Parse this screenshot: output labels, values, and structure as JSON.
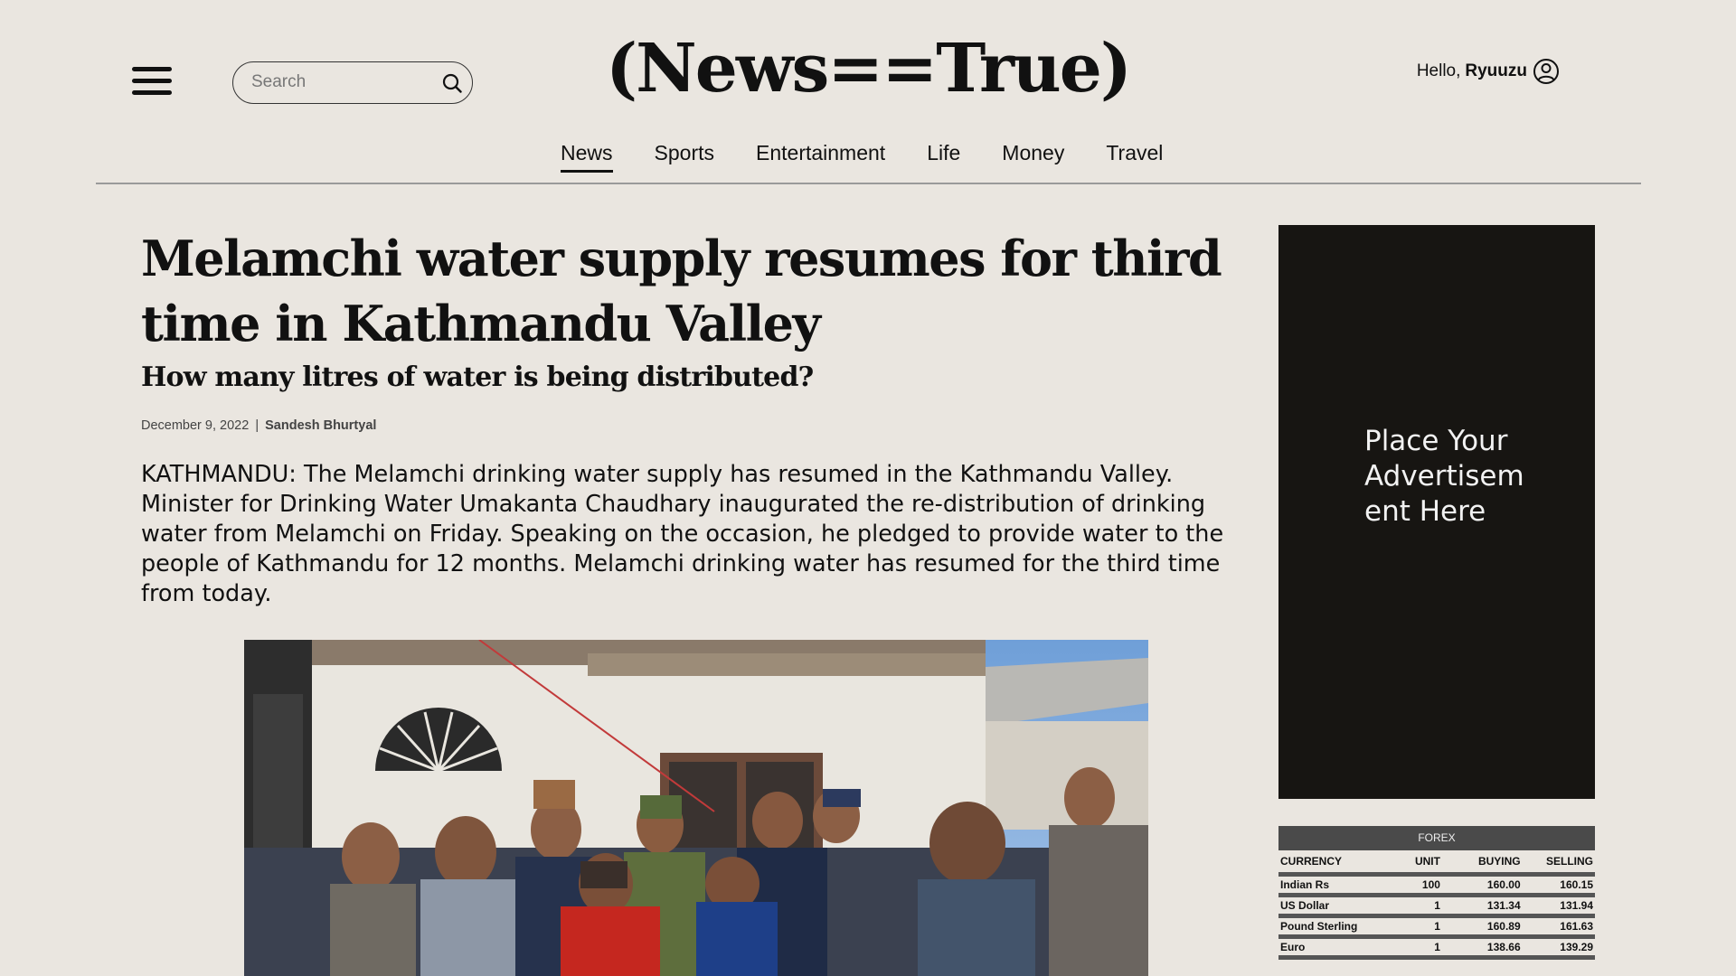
{
  "header": {
    "logo": "(News==True)",
    "search_placeholder": "Search",
    "greeting": "Hello,",
    "username": "Ryuuzu"
  },
  "nav": {
    "items": [
      {
        "label": "News",
        "active": true
      },
      {
        "label": "Sports",
        "active": false
      },
      {
        "label": "Entertainment",
        "active": false
      },
      {
        "label": "Life",
        "active": false
      },
      {
        "label": "Money",
        "active": false
      },
      {
        "label": "Travel",
        "active": false
      }
    ]
  },
  "article": {
    "headline": "Melamchi water supply resumes for third time in Kathmandu Valley",
    "subheadline": "How many litres of water is being distributed?",
    "date": "December 9, 2022",
    "separator": "|",
    "author": "Sandesh Bhurtyal",
    "body": "KATHMANDU: The Melamchi drinking water supply has resumed in the Kathmandu Valley. Minister for Drinking Water Umakanta Chaudhary inaugurated the re-distribution of drinking water from Melamchi on Friday. Speaking on the occasion, he pledged to provide water to the people of Kathmandu for 12 months. Melamchi drinking water has resumed for the third time from today."
  },
  "ad": {
    "text": "Place Your Advertisement Here"
  },
  "forex": {
    "title": "FOREX",
    "columns": [
      "CURRENCY",
      "UNIT",
      "BUYING",
      "SELLING"
    ],
    "rows": [
      [
        "Indian Rs",
        "100",
        "160.00",
        "160.15"
      ],
      [
        "US Dollar",
        "1",
        "131.34",
        "131.94"
      ],
      [
        "Pound Sterling",
        "1",
        "160.89",
        "161.63"
      ],
      [
        "Euro",
        "1",
        "138.66",
        "139.29"
      ]
    ]
  },
  "colors": {
    "page_background": "#eae6e0",
    "ad_background": "#171512",
    "forex_header": "#4a4a4a"
  }
}
